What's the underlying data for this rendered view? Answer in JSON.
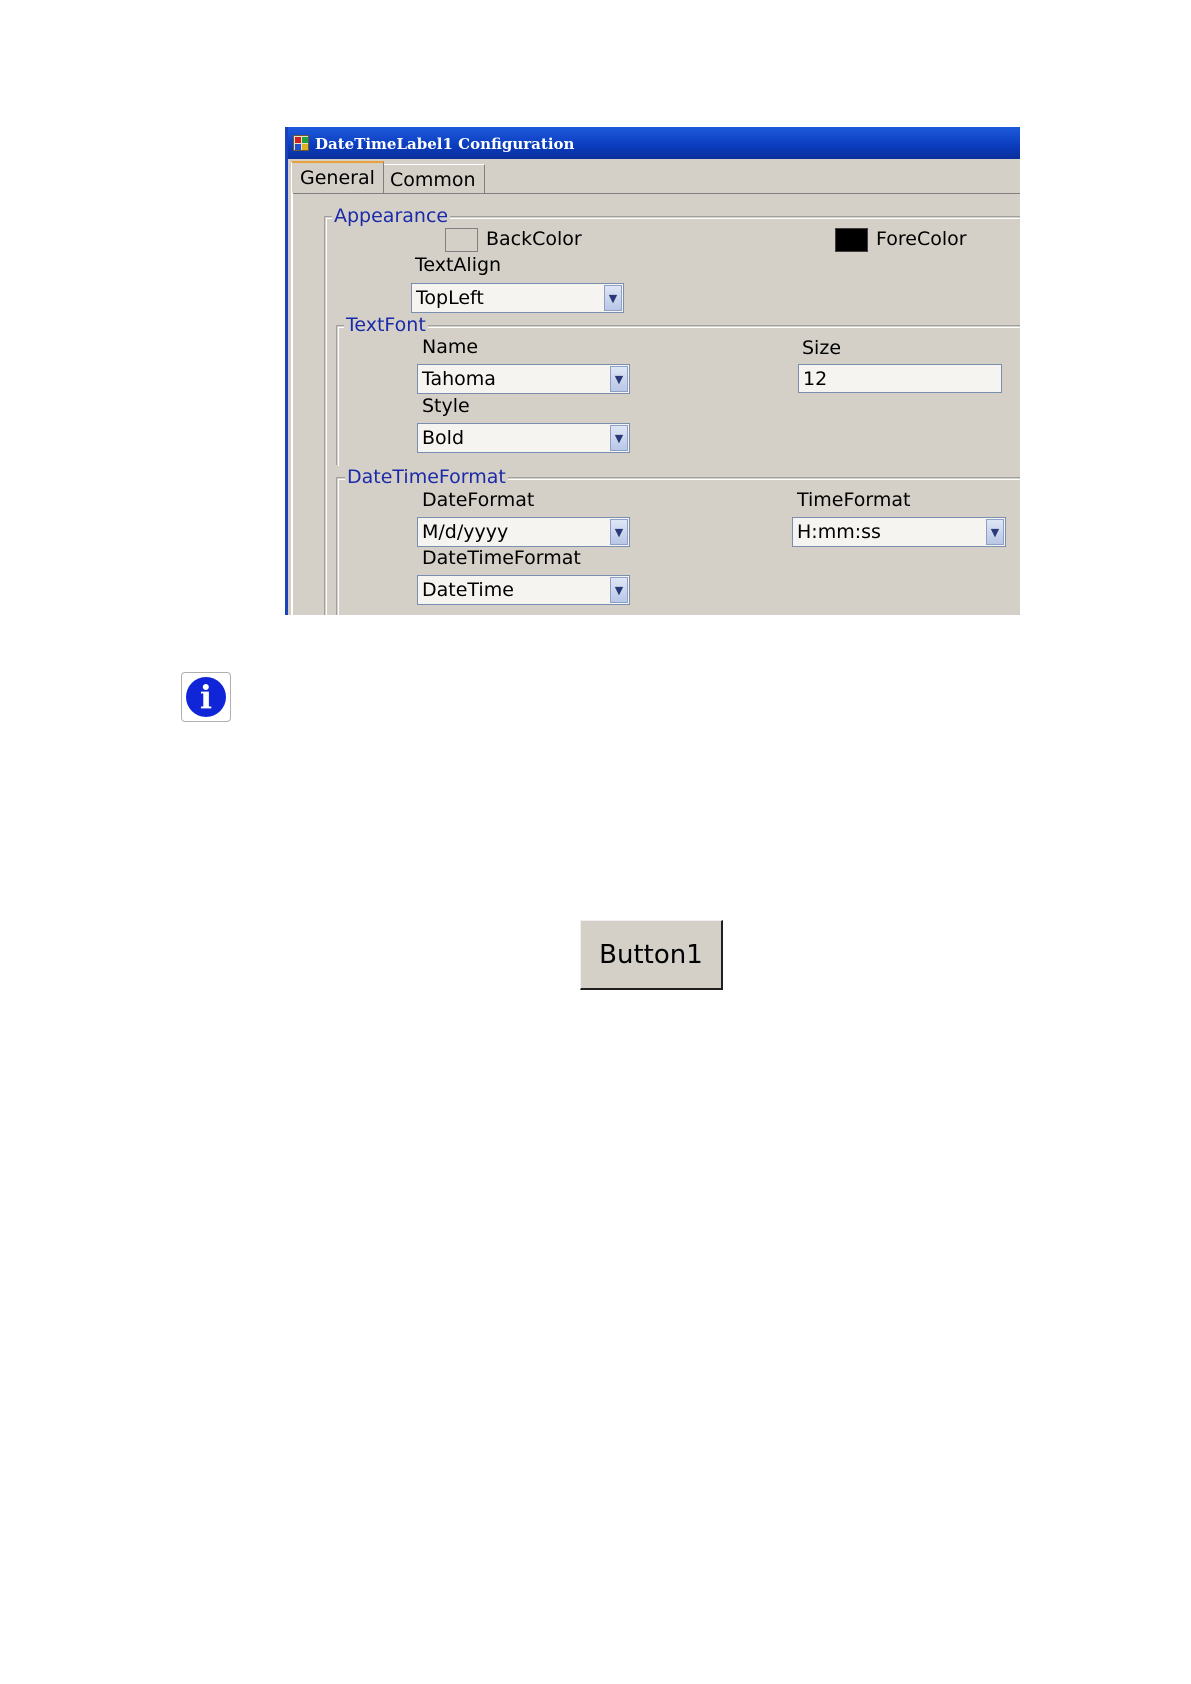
{
  "window": {
    "title": "DateTimeLabel1 Configuration",
    "tabs": [
      {
        "label": "General",
        "active": true
      },
      {
        "label": "Common",
        "active": false
      }
    ]
  },
  "appearance": {
    "legend": "Appearance",
    "backcolor_label": "BackColor",
    "backcolor_value": "#d4d0c8",
    "forecolor_label": "ForeColor",
    "forecolor_value": "#000000",
    "textalign_label": "TextAlign",
    "textalign_value": "TopLeft"
  },
  "textfont": {
    "legend": "TextFont",
    "name_label": "Name",
    "name_value": "Tahoma",
    "size_label": "Size",
    "size_value": "12",
    "style_label": "Style",
    "style_value": "Bold"
  },
  "datetimeformat": {
    "legend": "DateTimeFormat",
    "dateformat_label": "DateFormat",
    "dateformat_value": "M/d/yyyy",
    "timeformat_label": "TimeFormat",
    "timeformat_value": "H:mm:ss",
    "datetimeformat_label": "DateTimeFormat",
    "datetimeformat_value": "DateTime"
  },
  "info_icon": {
    "name": "info-icon",
    "glyph": "i"
  },
  "sample_button": {
    "label": "Button1"
  }
}
